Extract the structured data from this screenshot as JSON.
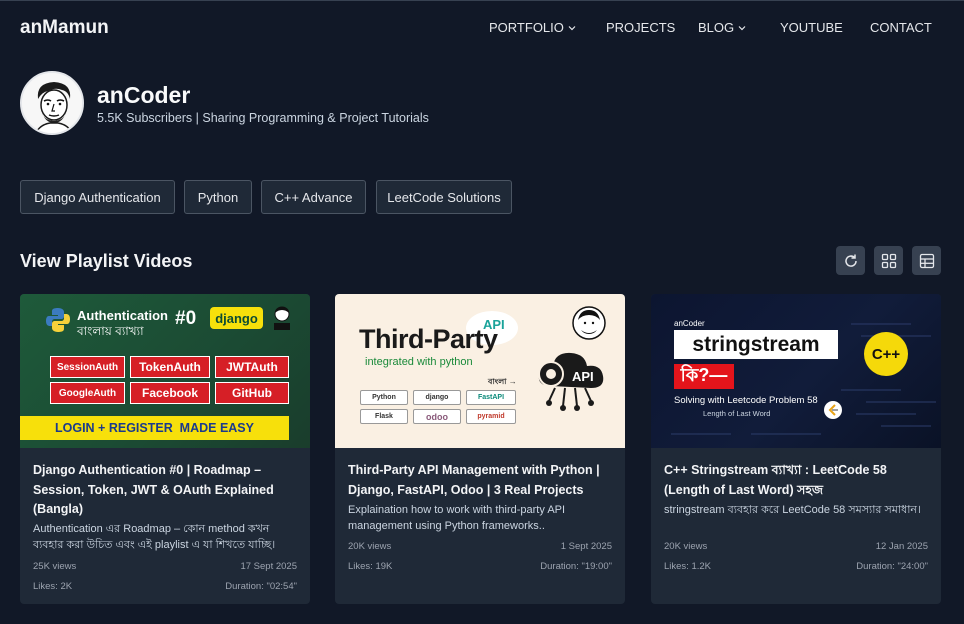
{
  "nav": {
    "brand": "anMamun",
    "items": [
      {
        "label": "PORTFOLIO",
        "dropdown": true
      },
      {
        "label": "PROJECTS",
        "dropdown": false
      },
      {
        "label": "BLOG",
        "dropdown": true
      },
      {
        "label": "YOUTUBE",
        "dropdown": false
      },
      {
        "label": "CONTACT",
        "dropdown": false
      }
    ]
  },
  "channel": {
    "name": "anCoder",
    "subtitle": "5.5K Subscribers | Sharing Programming & Project Tutorials"
  },
  "playlists": [
    "Django Authentication",
    "Python",
    "C++ Advance",
    "LeetCode Solutions"
  ],
  "section_title": "View Playlist Videos",
  "toolbar": {
    "icons": [
      "refresh-icon",
      "grid-icon",
      "table-icon"
    ]
  },
  "videos": [
    {
      "title": "Django Authentication #0 | Roadmap – Session, Token, JWT & OAuth Explained (Bangla)",
      "description": "Authentication এর Roadmap – কোন method কখন ব্যবহার করা উচিত এবং এই playlist এ যা শিখতে যাচ্ছি।",
      "views": "25K views",
      "date": "17 Sept 2025",
      "likes": "Likes: 2K",
      "duration": "Duration: \"02:54\"",
      "thumb": {
        "heading": "Authentication",
        "subheading": "বাংলায় ব্যাখ্যা",
        "number": "#0",
        "framework": "django",
        "chips": [
          "SessionAuth",
          "TokenAuth",
          "JWTAuth",
          "GoogleAuth",
          "Facebook",
          "GitHub"
        ],
        "banner": "LOGIN + REGISTER  MADE EASY"
      }
    },
    {
      "title": "Third-Party API Management with Python | Django, FastAPI, Odoo | 3 Real Projects",
      "description": "Explaination how to work with third-party API management using Python frameworks..",
      "views": "20K views",
      "date": "1 Sept 2025",
      "likes": "Likes: 19K",
      "duration": "Duration: \"19:00\"",
      "thumb": {
        "heading": "Third-Party",
        "tag": "API",
        "subheading": "integrated with python",
        "lang": "বাংলা →",
        "logos": [
          "Python",
          "django",
          "FastAPI",
          "Flask",
          "odoo",
          "pyramid"
        ],
        "cloud": "API"
      }
    },
    {
      "title": "C++ Stringstream ব্যাখ্যা : LeetCode 58 (Length of Last Word) সহজ",
      "description": "stringstream ব্যবহার করে LeetCode 58 সমস্যার সমাধান।",
      "views": "20K views",
      "date": "12 Jan 2025",
      "likes": "Likes: 1.2K",
      "duration": "Duration: \"24:00\"",
      "thumb": {
        "channel": "anCoder",
        "heading": "stringstream",
        "question": "কি?—",
        "badge": "C++",
        "caption": "Solving with Leetcode Problem 58",
        "small": "Length of Last Word"
      }
    }
  ],
  "colors": {
    "background": "#111827",
    "card": "#1f2937",
    "chip_red": "#d61f26",
    "banner_yellow": "#f7e00b",
    "cpp_yellow": "#f5d90a"
  }
}
